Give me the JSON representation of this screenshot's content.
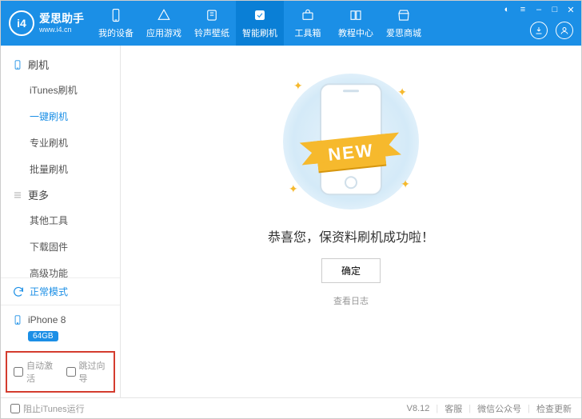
{
  "logo": {
    "mark": "i4",
    "title": "爱思助手",
    "url": "www.i4.cn"
  },
  "tabs": [
    {
      "key": "devices",
      "label": "我的设备"
    },
    {
      "key": "apps",
      "label": "应用游戏"
    },
    {
      "key": "ringtones",
      "label": "铃声壁纸"
    },
    {
      "key": "flash",
      "label": "智能刷机",
      "active": true
    },
    {
      "key": "toolbox",
      "label": "工具箱"
    },
    {
      "key": "tutorial",
      "label": "教程中心"
    },
    {
      "key": "mall",
      "label": "爱思商城"
    }
  ],
  "sidebar": {
    "group1": {
      "title": "刷机",
      "items": [
        {
          "label": "iTunes刷机"
        },
        {
          "label": "一键刷机",
          "active": true
        },
        {
          "label": "专业刷机"
        },
        {
          "label": "批量刷机"
        }
      ]
    },
    "group2": {
      "title": "更多",
      "items": [
        {
          "label": "其他工具"
        },
        {
          "label": "下载固件"
        },
        {
          "label": "高级功能"
        }
      ]
    },
    "mode": "正常模式",
    "device": {
      "name": "iPhone 8",
      "storage": "64GB"
    },
    "checks": {
      "auto_activate": "自动激活",
      "skip_guide": "跳过向导"
    }
  },
  "main": {
    "ribbon": "NEW",
    "message": "恭喜您，保资料刷机成功啦！",
    "confirm": "确定",
    "view_log": "查看日志"
  },
  "footer": {
    "block_itunes": "阻止iTunes运行",
    "version": "V8.12",
    "support": "客服",
    "wechat": "微信公众号",
    "update": "检查更新"
  }
}
